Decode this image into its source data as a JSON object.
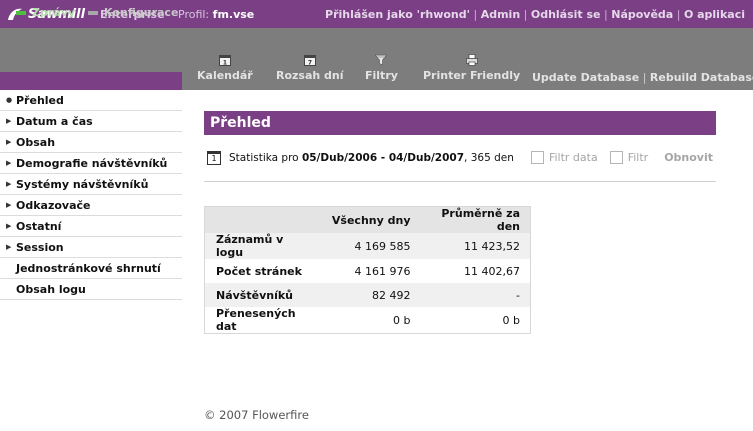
{
  "header": {
    "logo_text": "Sawmill",
    "edition": "Enterprise",
    "profile_label": "Profil:",
    "profile_name": "fm.vse",
    "links": [
      "Přihlášen jako 'rhwond'",
      "Admin",
      "Odhlásit se",
      "Nápověda",
      "O aplikaci"
    ]
  },
  "tabs": [
    {
      "label": "Zprávy",
      "color": "#4fbf3f"
    },
    {
      "label": "Konfigurace",
      "color": "#a8a8a8"
    }
  ],
  "toolbar": {
    "buttons": [
      {
        "label": "Kalendář",
        "icon": "calendar-icon"
      },
      {
        "label": "Rozsah dní",
        "icon": "date-range-icon"
      },
      {
        "label": "Filtry",
        "icon": "filter-icon"
      },
      {
        "label": "Printer Friendly",
        "icon": "printer-icon"
      }
    ],
    "update_database": "Update Database",
    "rebuild_database": "Rebuild Database"
  },
  "sidebar": {
    "items": [
      {
        "label": "Přehled",
        "marker": "bullet"
      },
      {
        "label": "Datum a čas",
        "marker": "arrow"
      },
      {
        "label": "Obsah",
        "marker": "arrow"
      },
      {
        "label": "Demografie návštěvníků",
        "marker": "arrow"
      },
      {
        "label": "Systémy návštěvníků",
        "marker": "arrow"
      },
      {
        "label": "Odkazovače",
        "marker": "arrow"
      },
      {
        "label": "Ostatní",
        "marker": "arrow"
      },
      {
        "label": "Session",
        "marker": "arrow"
      },
      {
        "label": "Jednostránkové shrnutí",
        "marker": "none"
      },
      {
        "label": "Obsah logu",
        "marker": "none"
      }
    ]
  },
  "main": {
    "title": "Přehled",
    "calendar_icon_text": "1",
    "stat_prefix": "Statistika pro ",
    "date_range": "05/Dub/2006 - 04/Dub/2007",
    "days": ", 365 den",
    "filter_date_label": "Filtr data",
    "filter_label": "Filtr",
    "refresh_label": "Obnovit"
  },
  "table": {
    "headers": [
      "",
      "Všechny dny",
      "Průměrně za den"
    ],
    "rows": [
      {
        "label": "Záznamů v logu",
        "all": "4 169 585",
        "avg": "11 423,52"
      },
      {
        "label": "Počet stránek",
        "all": "4 161 976",
        "avg": "11 402,67"
      },
      {
        "label": "Návštěvníků",
        "all": "82 492",
        "avg": "-"
      },
      {
        "label": "Přenesených dat",
        "all": "0 b",
        "avg": "0 b"
      }
    ]
  },
  "footer": "© 2007 Flowerfire",
  "colors": {
    "brand": "#7b3f86",
    "toolbar": "#7d7d7d"
  }
}
